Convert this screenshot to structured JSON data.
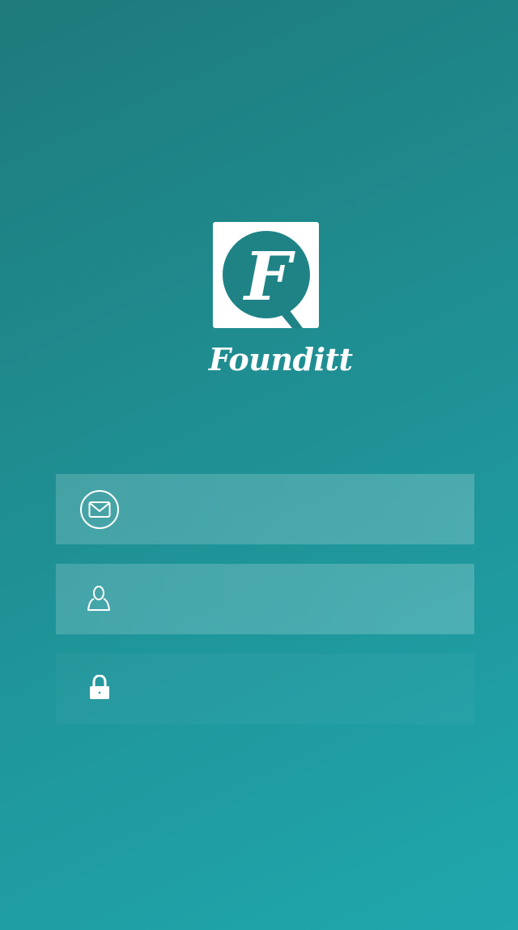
{
  "app": {
    "brand_name": "Founditt",
    "logo_letter": "F"
  },
  "form": {
    "email": {
      "icon": "envelope-icon",
      "value": "",
      "placeholder": ""
    },
    "username": {
      "icon": "user-icon",
      "value": "",
      "placeholder": ""
    },
    "password": {
      "icon": "lock-icon",
      "value": "",
      "placeholder": ""
    }
  },
  "colors": {
    "background_top": "#1e7a7b",
    "background_bottom": "#1fa7ad",
    "foreground": "#ffffff"
  }
}
